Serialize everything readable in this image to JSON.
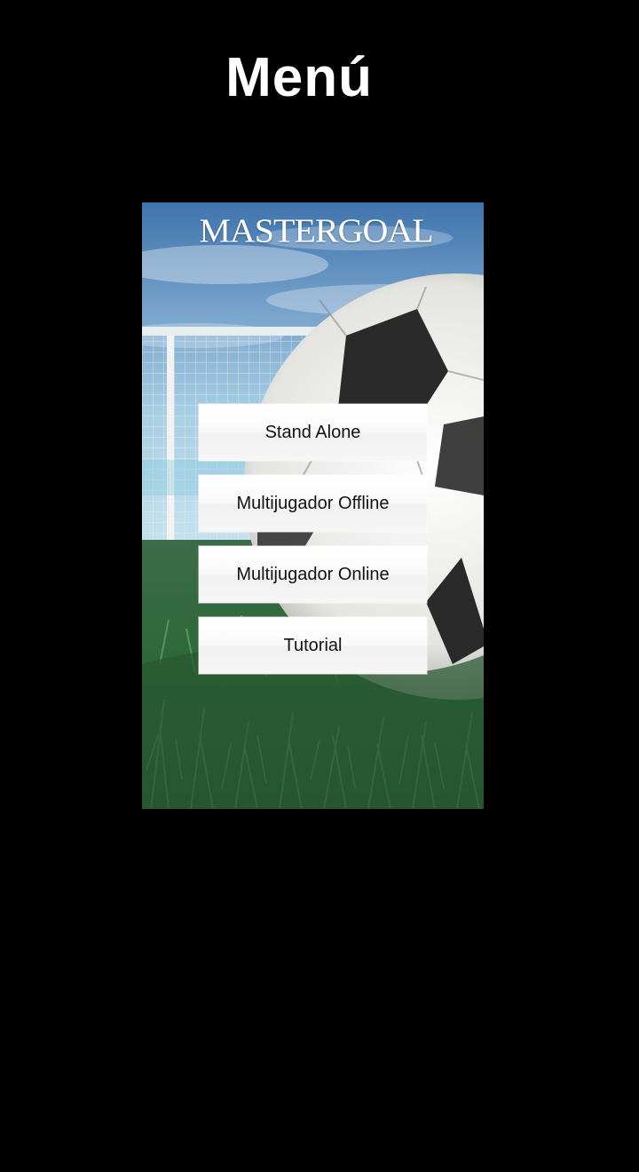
{
  "header": {
    "title": "Menú"
  },
  "panel": {
    "logo_text": "MASTERGOAL",
    "background_image": "soccer-ball-goal-grass"
  },
  "menu": {
    "buttons": [
      {
        "label": "Stand Alone"
      },
      {
        "label": "Multijugador Offline"
      },
      {
        "label": "Multijugador Online"
      },
      {
        "label": "Tutorial"
      }
    ]
  },
  "colors": {
    "page_background": "#000000",
    "title_color": "#ffffff",
    "button_background": "#f6f6f6",
    "button_text": "#111111"
  }
}
